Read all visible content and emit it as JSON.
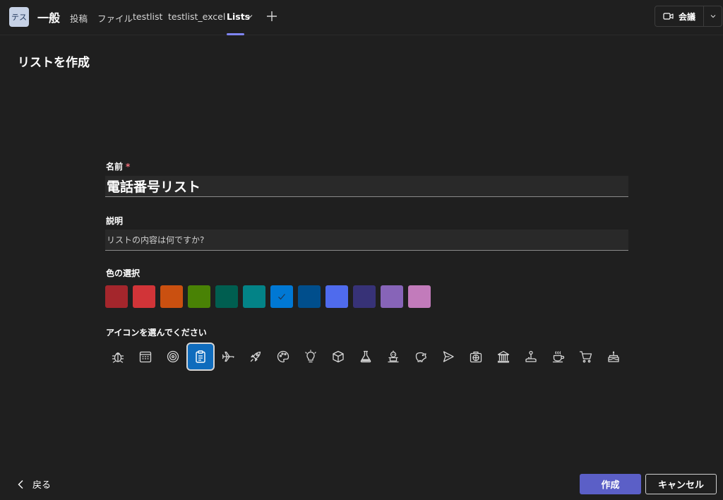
{
  "header": {
    "team_avatar": "テス",
    "channel": "一般",
    "tabs": [
      {
        "label": "投稿"
      },
      {
        "label": "ファイル"
      },
      {
        "label": "testlist"
      },
      {
        "label": "testlist_excel"
      },
      {
        "label": "Lists"
      }
    ],
    "meet_label": "会議"
  },
  "page": {
    "title": "リストを作成"
  },
  "form": {
    "name_label": "名前",
    "required_mark": "*",
    "name_value": "電話番号リスト",
    "description_label": "説明",
    "description_placeholder": "リストの内容は何ですか?",
    "color_label": "色の選択",
    "icon_label": "アイコンを選んでください"
  },
  "colors": [
    "#a4262c",
    "#d13438",
    "#ca5010",
    "#498205",
    "#005e50",
    "#038387",
    "#0078d4",
    "#004e8c",
    "#4f6bed",
    "#373277",
    "#8764b8",
    "#c27bbb"
  ],
  "selected_color_index": 6,
  "icons": [
    "bug-icon",
    "calendar-icon",
    "target-icon",
    "clipboard-icon",
    "airplane-icon",
    "rocket-icon",
    "palette-icon",
    "lightbulb-icon",
    "cube-icon",
    "flask-icon",
    "robot-icon",
    "piggy-bank-icon",
    "send-icon",
    "first-aid-kit-icon",
    "bank-icon",
    "joystick-icon",
    "coffee-cup-icon",
    "shopping-cart-icon",
    "cake-icon"
  ],
  "selected_icon_index": 3,
  "footer": {
    "back_label": "戻る",
    "create_label": "作成",
    "cancel_label": "キャンセル"
  }
}
